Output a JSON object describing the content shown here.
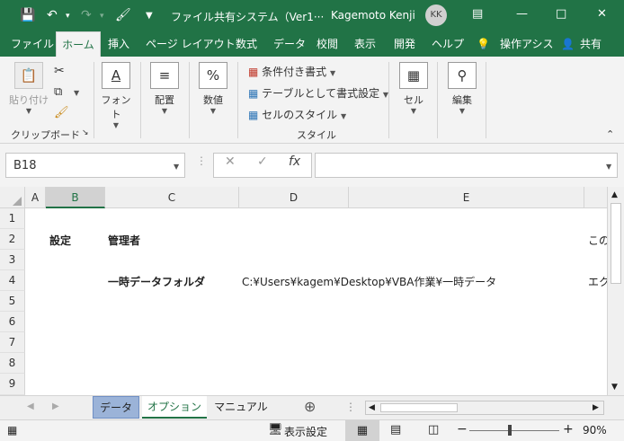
{
  "titlebar": {
    "title": "ファイル共有システム（Ver1···",
    "user": "Kagemoto Kenji",
    "avatar_initials": "KK"
  },
  "menu": {
    "tabs": [
      "ファイル",
      "ホーム",
      "挿入",
      "ページ レイアウト",
      "数式",
      "データ",
      "校閲",
      "表示",
      "開発",
      "ヘルプ"
    ],
    "tell_me": "操作アシス",
    "share": "共有"
  },
  "ribbon": {
    "paste": "貼り付け",
    "clipboard": "クリップボード",
    "font": "フォント",
    "alignment": "配置",
    "number": "数値",
    "conditional": "条件付き書式",
    "table": "テーブルとして書式設定",
    "cellstyle": "セルのスタイル",
    "style_group": "スタイル",
    "cells": "セル",
    "editing": "編集"
  },
  "formula": {
    "namebox": "B18",
    "fx": "fx"
  },
  "columns": [
    "A",
    "B",
    "C",
    "D",
    "E"
  ],
  "rows": [
    "1",
    "2",
    "3",
    "4",
    "5",
    "6",
    "7",
    "8",
    "9"
  ],
  "cells": {
    "b2": "設定",
    "c2": "管理者",
    "f2": "この",
    "c4": "一時データフォルダ",
    "d4": "C:¥Users¥kagem¥Desktop¥VBA作業¥一時データ",
    "f4": "エク"
  },
  "sheets": [
    "データ",
    "オプション",
    "マニュアル"
  ],
  "status": {
    "display_settings": "表示設定",
    "zoom": "90%"
  },
  "colors": {
    "brand": "#217346",
    "ribbon_bg": "#f3f3f3"
  }
}
